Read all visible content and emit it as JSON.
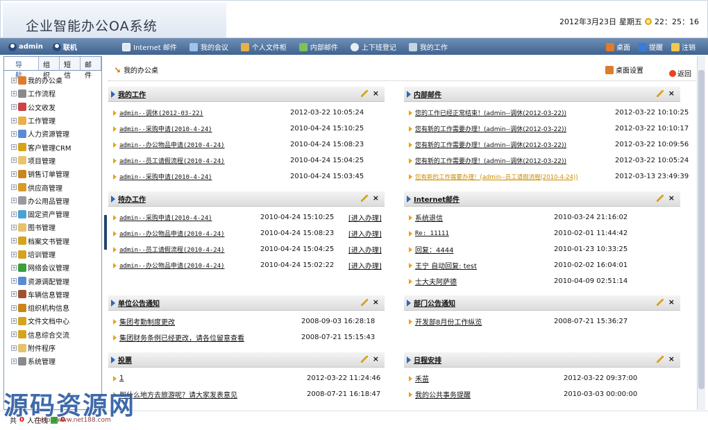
{
  "header": {
    "app_title": "企业智能办公OA系统",
    "date": "2012年3月23日",
    "weekday": "星期五",
    "time": "22：25：16"
  },
  "toolbar": {
    "user": "admin",
    "contact": "联机",
    "nav": [
      {
        "label": "Internet 邮件",
        "icon": "mail-icon"
      },
      {
        "label": "我的会议",
        "icon": "meeting-icon"
      },
      {
        "label": "个人文件柜",
        "icon": "file-cabinet-icon"
      },
      {
        "label": "内部邮件",
        "icon": "internal-mail-icon"
      },
      {
        "label": "上下班登记",
        "icon": "attendance-icon"
      },
      {
        "label": "我的工作",
        "icon": "work-icon"
      }
    ],
    "right": [
      {
        "label": "桌面",
        "icon": "desktop-icon"
      },
      {
        "label": "提醒",
        "icon": "remind-icon"
      },
      {
        "label": "注销",
        "icon": "logout-icon"
      }
    ]
  },
  "sidebar": {
    "tabs": [
      "导航",
      "组织",
      "短信",
      "邮件"
    ],
    "items": [
      "我的办公桌",
      "工作流程",
      "公文收发",
      "工作管理",
      "人力资源管理",
      "客户管理CRM",
      "项目管理",
      "销售订单管理",
      "供应商管理",
      "办公用品管理",
      "固定资产管理",
      "图书管理",
      "档案文书管理",
      "培训管理",
      "网络会议管理",
      "资源调配管理",
      "车辆信息管理",
      "组织机构信息",
      "文件文档中心",
      "信息综合交流",
      "附件程序",
      "系统管理"
    ]
  },
  "main": {
    "breadcrumb": "我的办公桌",
    "desk_settings": "桌面设置",
    "back": "返回"
  },
  "panels": [
    {
      "title": "我的工作",
      "rows": [
        {
          "title": "admin--调休(2012-03-22)",
          "time": "2012-03-22 10:05:24"
        },
        {
          "title": "admin--采购申请(2010-4-24)",
          "time": "2010-04-24 15:10:25"
        },
        {
          "title": "admin--办公物品申请(2010-4-24)",
          "time": "2010-04-24 15:08:23"
        },
        {
          "title": "admin--员工请假流程(2010-4-24)",
          "time": "2010-04-24 15:04:25"
        },
        {
          "title": "admin--采购申请(2010-4-24)",
          "time": "2010-04-24 15:03:45"
        }
      ]
    },
    {
      "title": "内部邮件",
      "rows": [
        {
          "title": "您的工作已经正常结束！(admin--调休(2012-03-22))",
          "time": "2012-03-22 10:10:25"
        },
        {
          "title": "您有新的工作需要办理！(admin--调休(2012-03-22))",
          "time": "2012-03-22 10:10:17"
        },
        {
          "title": "您有新的工作需要办理！(admin--调休(2012-03-22))",
          "time": "2012-03-22 10:09:56"
        },
        {
          "title": "您有新的工作需要办理！(admin--调休(2012-03-22))",
          "time": "2012-03-22 10:05:24"
        },
        {
          "title": "您有新的工作需要办理！(admin--员工请假流程(2010-4-24))",
          "time": "2012-03-13 23:49:39"
        }
      ]
    },
    {
      "title": "待办工作",
      "action_label": "[进入办理]",
      "rows": [
        {
          "title": "admin--采购申请(2010-4-24)",
          "time": "2010-04-24 15:10:25"
        },
        {
          "title": "admin--办公物品申请(2010-4-24)",
          "time": "2010-04-24 15:08:23"
        },
        {
          "title": "admin--员工请假流程(2010-4-24)",
          "time": "2010-04-24 15:04:25"
        },
        {
          "title": "admin--办公物品申请(2010-4-24)",
          "time": "2010-04-24 15:02:22"
        }
      ]
    },
    {
      "title": "Internet邮件",
      "rows": [
        {
          "title": "系统退信",
          "time": "2010-03-24 21:16:02"
        },
        {
          "title": "Re: 11111",
          "time": "2010-02-01 11:44:42"
        },
        {
          "title": "回复：4444",
          "time": "2010-01-23 10:33:25"
        },
        {
          "title": "王宁 自动回复: test",
          "time": "2010-02-02 16:04:01"
        },
        {
          "title": "士大夫阿萨德",
          "time": "2010-04-09 02:51:14"
        }
      ]
    },
    {
      "title": "单位公告通知",
      "rows": [
        {
          "title": "集团考勤制度更改",
          "time": "2008-09-03 16:28:18"
        },
        {
          "title": "集团财务条例已经更改，请各位留意查看",
          "time": "2008-07-21 15:15:43"
        }
      ]
    },
    {
      "title": "部门公告通知",
      "rows": [
        {
          "title": "开发部8月份工作纵览",
          "time": "2008-07-21 15:36:27"
        }
      ]
    },
    {
      "title": "投票",
      "rows": [
        {
          "title": "1",
          "time": "2012-03-22 11:24:46"
        },
        {
          "title": "到什么地方去旅游呢？请大家发表意见",
          "time": "2008-07-21 16:18:47"
        }
      ]
    },
    {
      "title": "日程安排",
      "rows": [
        {
          "title": "禾苗",
          "time": "2012-03-22 09:37:00"
        },
        {
          "title": "我的公共事务提醒",
          "time": "2010-03-03 00:00:00"
        }
      ]
    }
  ],
  "status": {
    "prefix": "共",
    "count": "0",
    "suffix": "人在线",
    "online": "0"
  },
  "watermark": {
    "text": "源码资源网",
    "url": "http://www.net188.com"
  }
}
